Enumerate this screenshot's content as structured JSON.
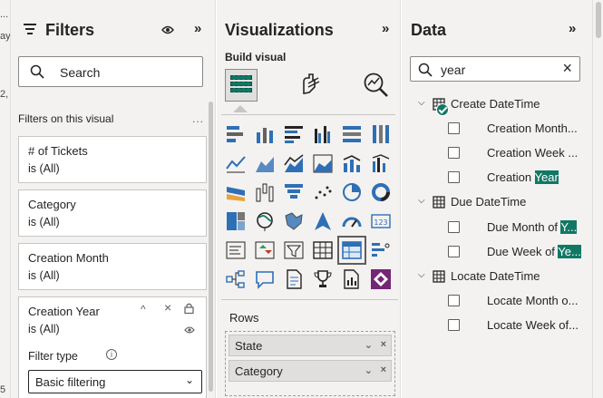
{
  "canvas_edge": {
    "texts": [
      "...",
      "ay",
      "2,",
      "5"
    ]
  },
  "filters": {
    "title": "Filters",
    "search_placeholder": "Search",
    "section_label": "Filters on this visual",
    "more": "...",
    "cards": [
      {
        "title": "# of Tickets",
        "state": "is (All)"
      },
      {
        "title": "Category",
        "state": "is (All)"
      },
      {
        "title": "Creation Month",
        "state": "is (All)"
      },
      {
        "title": "Creation Year",
        "state": "is (All)"
      }
    ],
    "filter_type_label": "Filter type",
    "filter_type_value": "Basic filtering",
    "icons": {
      "chevron_up": "^",
      "close": "×",
      "more_expand": "»"
    }
  },
  "visualizations": {
    "title": "Visualizations",
    "subheading": "Build visual",
    "rows_label": "Rows",
    "fields": [
      {
        "label": "State"
      },
      {
        "label": "Category"
      }
    ],
    "gallery": [
      "stacked-bar-chart-icon",
      "stacked-column-chart-icon",
      "clustered-bar-chart-icon",
      "clustered-column-chart-icon",
      "100-stacked-bar-chart-icon",
      "100-stacked-column-chart-icon",
      "line-chart-icon",
      "area-chart-icon",
      "stacked-area-chart-icon",
      "100-stacked-area-chart-icon",
      "line-and-column-chart-icon",
      "line-and-clustered-column-chart-icon",
      "ribbon-chart-icon",
      "waterfall-chart-icon",
      "funnel-chart-icon",
      "scatter-chart-icon",
      "pie-chart-icon",
      "donut-chart-icon",
      "treemap-icon",
      "map-icon",
      "filled-map-icon",
      "azure-map-icon",
      "gauge-icon",
      "card-icon",
      "multi-row-card-icon",
      "kpi-icon",
      "slicer-icon",
      "table-icon",
      "matrix-icon",
      "key-influencers-icon",
      "decomposition-tree-icon",
      "qna-icon",
      "smart-narrative-icon",
      "metrics-icon",
      "paginated-report-icon",
      "power-apps-icon"
    ],
    "selected_index": 28
  },
  "data": {
    "title": "Data",
    "search_value": "year",
    "tables": [
      {
        "name": "Create DateTime",
        "fields": [
          {
            "pre": "Creation Month...",
            "hl": ""
          },
          {
            "pre": "Creation Week ...",
            "hl": ""
          },
          {
            "pre": "Creation ",
            "hl": "Year"
          }
        ]
      },
      {
        "name": "Due DateTime",
        "fields": [
          {
            "pre": "Due Month of ",
            "hl": "Y..."
          },
          {
            "pre": "Due Week of ",
            "hl": "Ye..."
          }
        ]
      },
      {
        "name": "Locate DateTime",
        "fields": [
          {
            "pre": "Locate Month o...",
            "hl": " "
          },
          {
            "pre": "Locate Week of...",
            "hl": " "
          }
        ]
      }
    ]
  },
  "colors": {
    "accent": "#117865",
    "pane_bg": "#f3f2f1",
    "border": "#c8c6c4"
  }
}
